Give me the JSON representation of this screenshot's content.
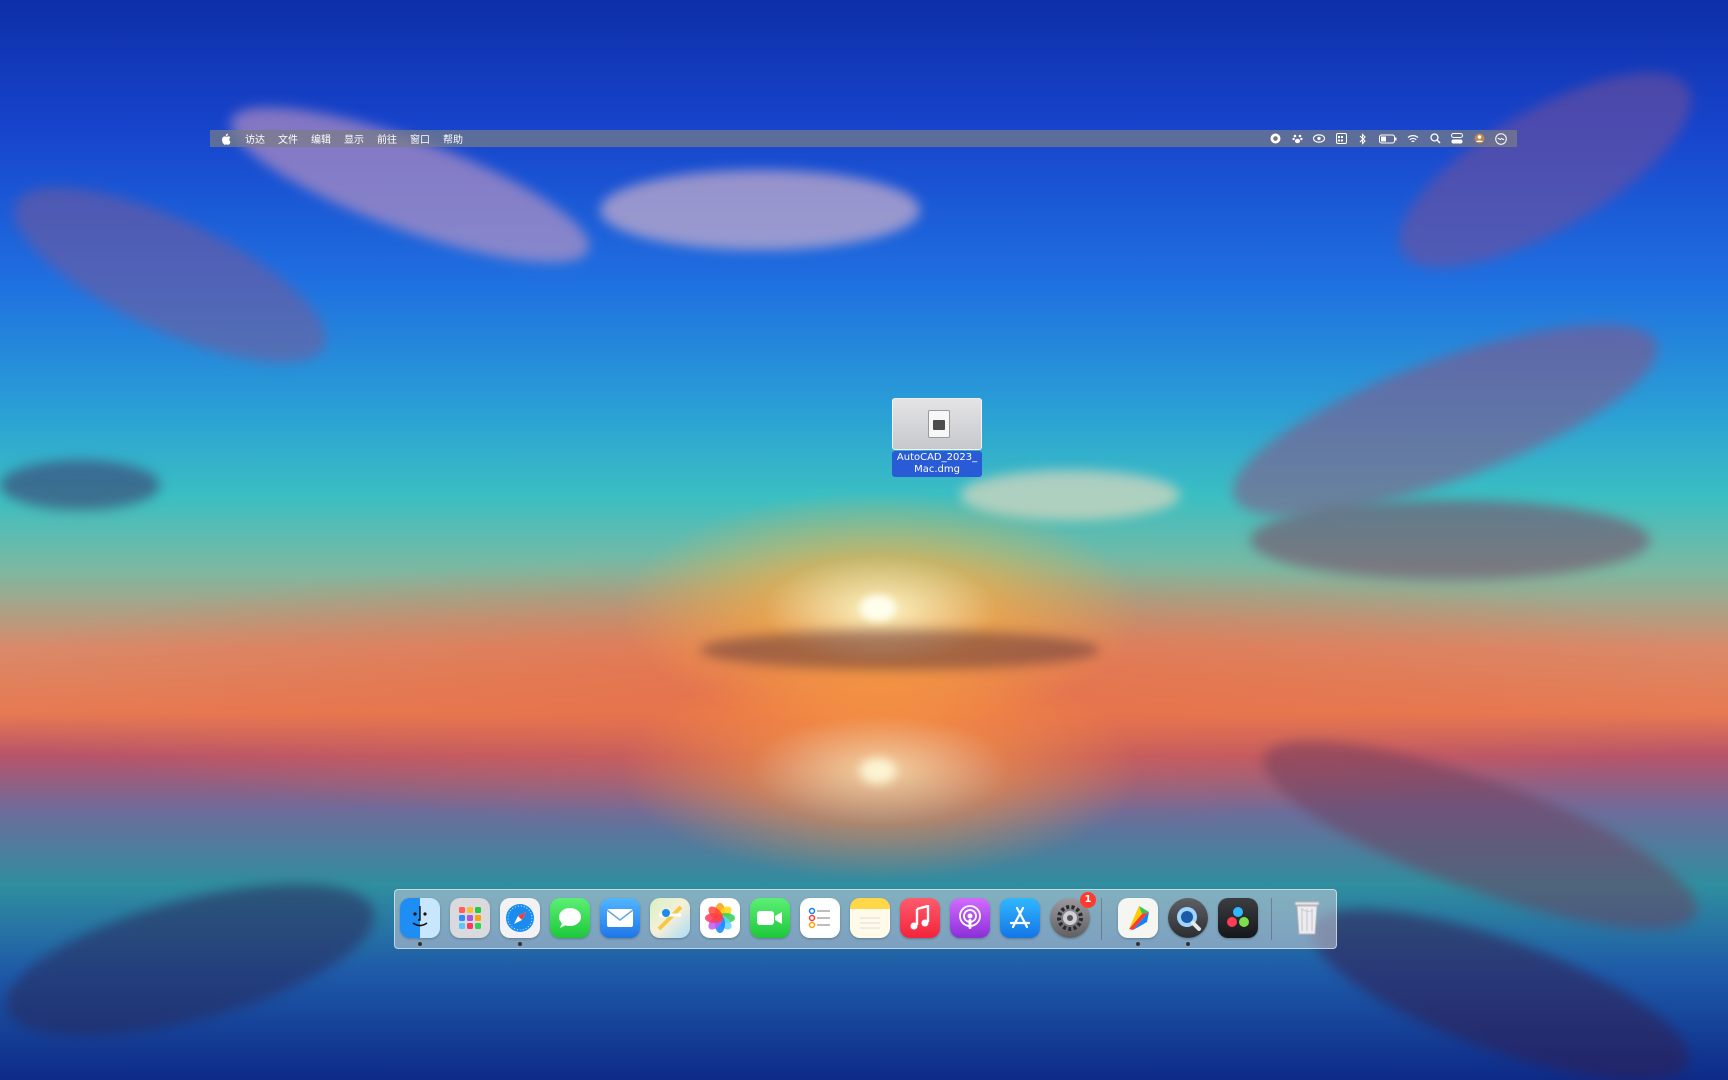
{
  "menubar": {
    "apple_icon": "apple-icon",
    "items": [
      "访达",
      "文件",
      "编辑",
      "显示",
      "前往",
      "窗口",
      "帮助"
    ],
    "status_icons": [
      "record-icon",
      "paw-icon",
      "eye-icon",
      "calendar-icon",
      "bluetooth-icon",
      "battery-icon",
      "wifi-icon",
      "search-icon",
      "control-center-icon",
      "user-icon",
      "siri-icon"
    ]
  },
  "desktop_file": {
    "name": "AutoCAD_2023_Mac.dmg",
    "icon": "disk-image-icon"
  },
  "dock": {
    "apps": [
      {
        "name": "Finder",
        "icon": "finder-icon",
        "running": true
      },
      {
        "name": "Launchpad",
        "icon": "launchpad-icon",
        "running": false
      },
      {
        "name": "Safari",
        "icon": "safari-icon",
        "running": true
      },
      {
        "name": "Messages",
        "icon": "messages-icon",
        "running": false
      },
      {
        "name": "Mail",
        "icon": "mail-icon",
        "running": false
      },
      {
        "name": "Maps",
        "icon": "maps-icon",
        "running": false
      },
      {
        "name": "Photos",
        "icon": "photos-icon",
        "running": false
      },
      {
        "name": "FaceTime",
        "icon": "facetime-icon",
        "running": false
      },
      {
        "name": "Reminders",
        "icon": "reminders-icon",
        "running": false
      },
      {
        "name": "Notes",
        "icon": "notes-icon",
        "running": false
      },
      {
        "name": "Music",
        "icon": "music-icon",
        "running": false
      },
      {
        "name": "Podcasts",
        "icon": "podcasts-icon",
        "running": false
      },
      {
        "name": "App Store",
        "icon": "app-store-icon",
        "running": false
      },
      {
        "name": "System Preferences",
        "icon": "system-preferences-icon",
        "running": false,
        "badge": "1"
      },
      {
        "name": "Pages Creator",
        "icon": "colorful-app-icon",
        "running": true
      },
      {
        "name": "QuickTime",
        "icon": "quicktime-icon",
        "running": true
      },
      {
        "name": "DaVinci Resolve",
        "icon": "davinci-icon",
        "running": false
      },
      {
        "name": "Trash",
        "icon": "trash-icon",
        "running": false
      }
    ]
  },
  "colors": {
    "menubar_bg": "#787d87",
    "selection_blue": "#2a5bd7",
    "badge_red": "#ff3b30"
  }
}
